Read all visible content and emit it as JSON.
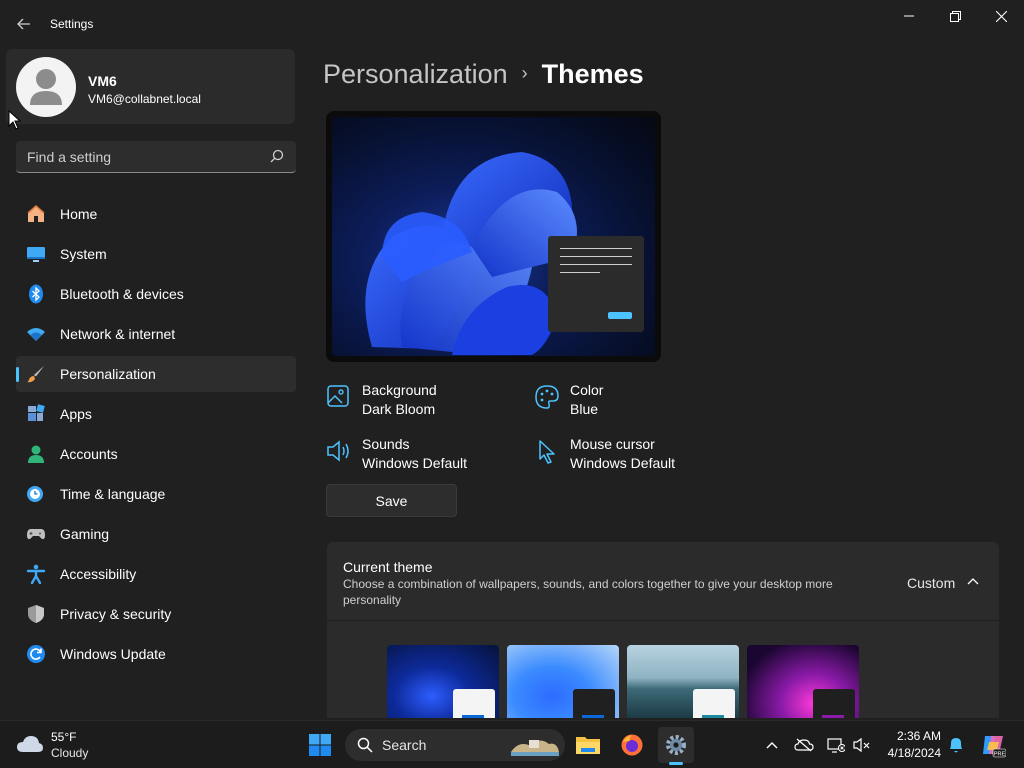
{
  "window": {
    "title": "Settings"
  },
  "profile": {
    "name": "VM6",
    "email": "VM6@collabnet.local"
  },
  "search": {
    "placeholder": "Find a setting"
  },
  "nav": {
    "items": [
      {
        "label": "Home",
        "icon": "home-icon"
      },
      {
        "label": "System",
        "icon": "system-icon"
      },
      {
        "label": "Bluetooth & devices",
        "icon": "bluetooth-icon"
      },
      {
        "label": "Network & internet",
        "icon": "wifi-icon"
      },
      {
        "label": "Personalization",
        "icon": "brush-icon",
        "active": true
      },
      {
        "label": "Apps",
        "icon": "apps-icon"
      },
      {
        "label": "Accounts",
        "icon": "accounts-icon"
      },
      {
        "label": "Time & language",
        "icon": "clock-globe-icon"
      },
      {
        "label": "Gaming",
        "icon": "gamepad-icon"
      },
      {
        "label": "Accessibility",
        "icon": "accessibility-icon"
      },
      {
        "label": "Privacy & security",
        "icon": "shield-icon"
      },
      {
        "label": "Windows Update",
        "icon": "update-icon"
      }
    ]
  },
  "breadcrumb": {
    "parent": "Personalization",
    "separator": "›",
    "current": "Themes"
  },
  "theme_props": {
    "background": {
      "title": "Background",
      "value": "Dark Bloom"
    },
    "color": {
      "title": "Color",
      "value": "Blue"
    },
    "sounds": {
      "title": "Sounds",
      "value": "Windows Default"
    },
    "cursor": {
      "title": "Mouse cursor",
      "value": "Windows Default"
    }
  },
  "actions": {
    "save_label": "Save"
  },
  "current_theme": {
    "title": "Current theme",
    "description": "Choose a combination of wallpapers, sounds, and colors together to give your desktop more personality",
    "value": "Custom"
  },
  "taskbar": {
    "weather_temp": "55°F",
    "weather_condition": "Cloudy",
    "search_label": "Search",
    "time": "2:36 AM",
    "date": "4/18/2024"
  },
  "colors": {
    "accent": "#4cc2ff",
    "background": "#202020",
    "card": "#2b2b2b"
  }
}
